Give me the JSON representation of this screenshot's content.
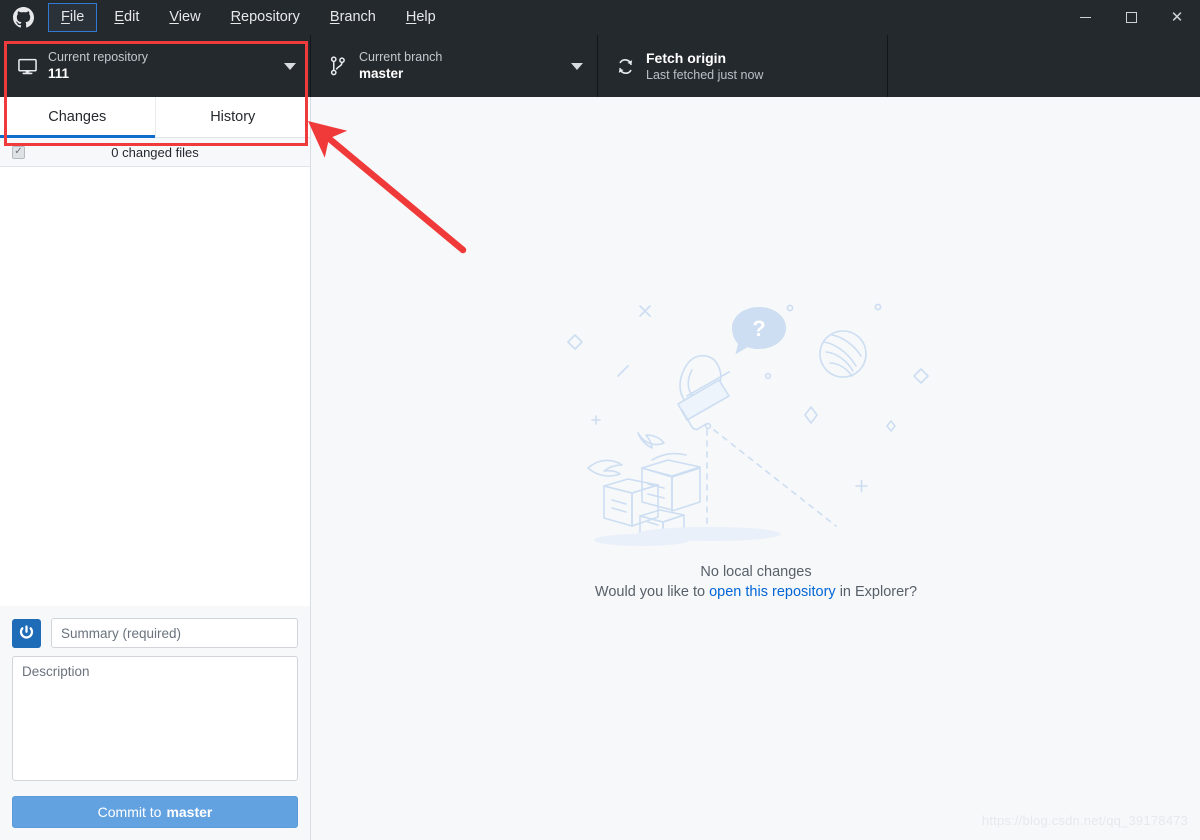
{
  "window": {
    "logo_icon": "github-mark-icon",
    "controls": {
      "minimize": "minimize-icon",
      "maximize": "maximize-icon",
      "close": "close-icon"
    }
  },
  "menubar": {
    "items": [
      {
        "label": "File",
        "mnemonic": "F",
        "rest": "ile",
        "focused": true
      },
      {
        "label": "Edit",
        "mnemonic": "E",
        "rest": "dit",
        "focused": false
      },
      {
        "label": "View",
        "mnemonic": "V",
        "rest": "iew",
        "focused": false
      },
      {
        "label": "Repository",
        "mnemonic": "R",
        "rest": "epository",
        "focused": false
      },
      {
        "label": "Branch",
        "mnemonic": "B",
        "rest": "ranch",
        "focused": false
      },
      {
        "label": "Help",
        "mnemonic": "H",
        "rest": "elp",
        "focused": false
      }
    ]
  },
  "toolbar": {
    "repository": {
      "icon": "desktop-monitor-icon",
      "label": "Current repository",
      "value": "111",
      "caret": "chevron-down-icon"
    },
    "branch": {
      "icon": "git-branch-icon",
      "label": "Current branch",
      "value": "master",
      "caret": "chevron-down-icon"
    },
    "fetch": {
      "icon": "sync-icon",
      "title": "Fetch origin",
      "subtitle": "Last fetched just now"
    }
  },
  "sidebar": {
    "tabs": [
      {
        "label": "Changes",
        "active": true
      },
      {
        "label": "History",
        "active": false
      }
    ],
    "changed_files": {
      "checkbox_state": "indeterminate",
      "label": "0 changed files"
    },
    "commit": {
      "avatar_icon": "user-avatar-icon",
      "summary_placeholder": "Summary (required)",
      "summary_value": "",
      "description_placeholder": "Description",
      "description_value": "",
      "button_prefix": "Commit to",
      "button_branch": "master"
    }
  },
  "main": {
    "illustration": "no-local-changes-illustration",
    "title": "No local changes",
    "question_prefix": "Would you like to",
    "question_link": "open this repository",
    "question_suffix": "in Explorer?"
  },
  "annotations": {
    "highlight_box": "red-rectangle-highlight",
    "arrow": "red-arrow-pointer",
    "color": "#ef3b3b"
  },
  "watermark": {
    "text": "https://blog.csdn.net/qq_39178473"
  },
  "colors": {
    "titlebar_bg": "#24292e",
    "toolbar_bg": "#24292e",
    "accent_blue": "#0366d6",
    "tab_underline": "#0f6ecd",
    "commit_button": "#63a2e0",
    "panel_bg": "#f6f8fa",
    "illustration": "#cddef2"
  }
}
